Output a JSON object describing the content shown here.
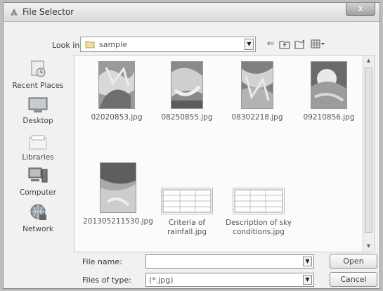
{
  "window": {
    "title": "File Selector",
    "close_label": "x"
  },
  "toolbar": {
    "look_in_label": "Look in:",
    "look_in_value": "sample",
    "icons": [
      "back-arrow-icon",
      "up-folder-icon",
      "new-folder-icon",
      "view-menu-icon"
    ]
  },
  "places": [
    {
      "label": "Recent Places",
      "icon": "recent-places-icon"
    },
    {
      "label": "Desktop",
      "icon": "desktop-icon"
    },
    {
      "label": "Libraries",
      "icon": "libraries-icon"
    },
    {
      "label": "Computer",
      "icon": "computer-icon"
    },
    {
      "label": "Network",
      "icon": "network-icon"
    }
  ],
  "files": [
    {
      "name": "02020853.jpg"
    },
    {
      "name": "08250855.jpg"
    },
    {
      "name": "08302218.jpg"
    },
    {
      "name": "09210856.jpg"
    },
    {
      "name": "201305211530.jpg"
    },
    {
      "name_line1": "Criteria of",
      "name_line2": "rainfall.jpg"
    },
    {
      "name_line1": "Description of sky",
      "name_line2": "conditions.jpg"
    }
  ],
  "footer": {
    "file_name_label": "File name:",
    "file_name_value": "",
    "files_of_type_label": "Files of type:",
    "files_of_type_value": "(*.jpg)",
    "open_label": "Open",
    "cancel_label": "Cancel"
  }
}
